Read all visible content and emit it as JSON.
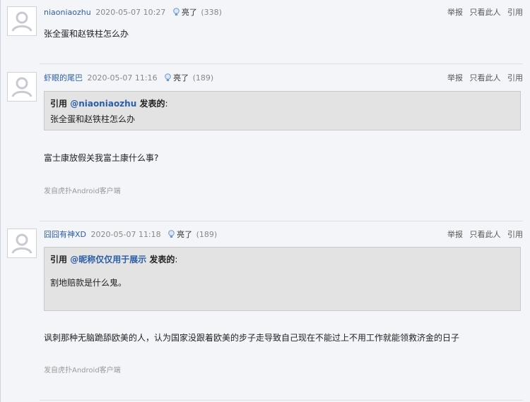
{
  "actions": {
    "report": "举报",
    "only_this": "只看此人",
    "quote": "引用"
  },
  "posts": [
    {
      "user": "niaoniaozhu",
      "time": "2020-05-07 10:27",
      "light_label": "亮了",
      "light_count": "(338)",
      "content": "张全蛋和赵铁柱怎么办"
    },
    {
      "user": "虾眼的尾巴",
      "time": "2020-05-07 11:16",
      "light_label": "亮了",
      "light_count": "(189)",
      "quote": {
        "prefix": "引用 ",
        "at_user": "@niaoniaozhu",
        "suffix": " 发表的",
        "colon": ":",
        "body": "张全蛋和赵铁柱怎么办"
      },
      "content": "富士康放假关我富土康什么事?",
      "source": "发自虎扑Android客户端"
    },
    {
      "user": "囧囧有神XD",
      "time": "2020-05-07 11:18",
      "light_label": "亮了",
      "light_count": "(189)",
      "quote": {
        "prefix": "引用 ",
        "at_user": "@昵称仅仅用于展示",
        "suffix": " 发表的",
        "colon": ":",
        "body": "割地赔款是什么鬼。"
      },
      "content": "讽刺那种无脑跪舔欧美的人，认为国家没跟着欧美的步子走导致自己现在不能过上不用工作就能领救济金的日子",
      "source": "发自虎扑Android客户端"
    }
  ]
}
